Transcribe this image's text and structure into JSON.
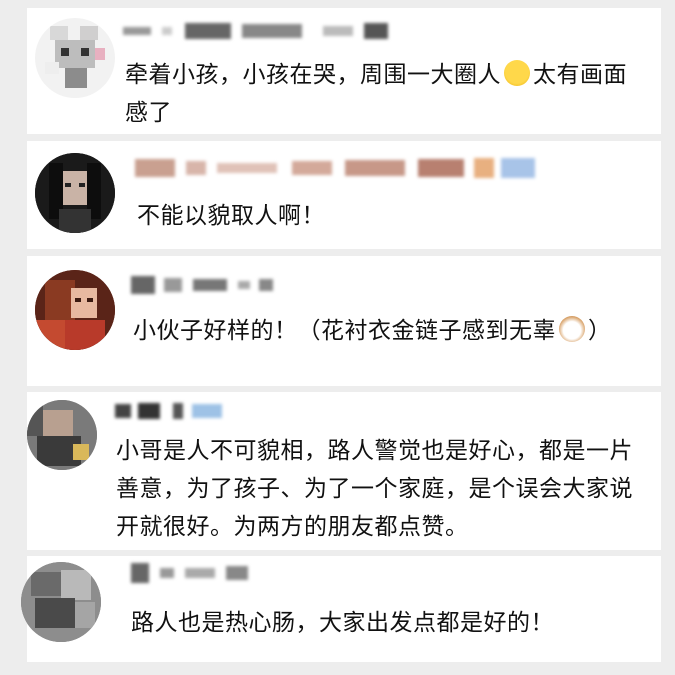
{
  "comments": [
    {
      "text_a": "牵着小孩，小孩在哭，周围一大圈人",
      "emoji": "laughing-crying-emoji",
      "text_b": "太有画面感了"
    },
    {
      "text": "不能以貌取人啊！"
    },
    {
      "text_a": "小伙子好样的！（花衬衣金链子感到无辜",
      "emoji": "dog-face-emoji",
      "text_b": "）"
    },
    {
      "text": "小哥是人不可貌相，路人警觉也是好心，都是一片善意，为了孩子、为了一个家庭，是个误会大家说开就很好。为两方的朋友都点赞。"
    },
    {
      "text": "路人也是热心肠，大家出发点都是好的！"
    }
  ],
  "colors": {
    "background": "#ededed",
    "card": "#ffffff",
    "text": "#111111"
  }
}
